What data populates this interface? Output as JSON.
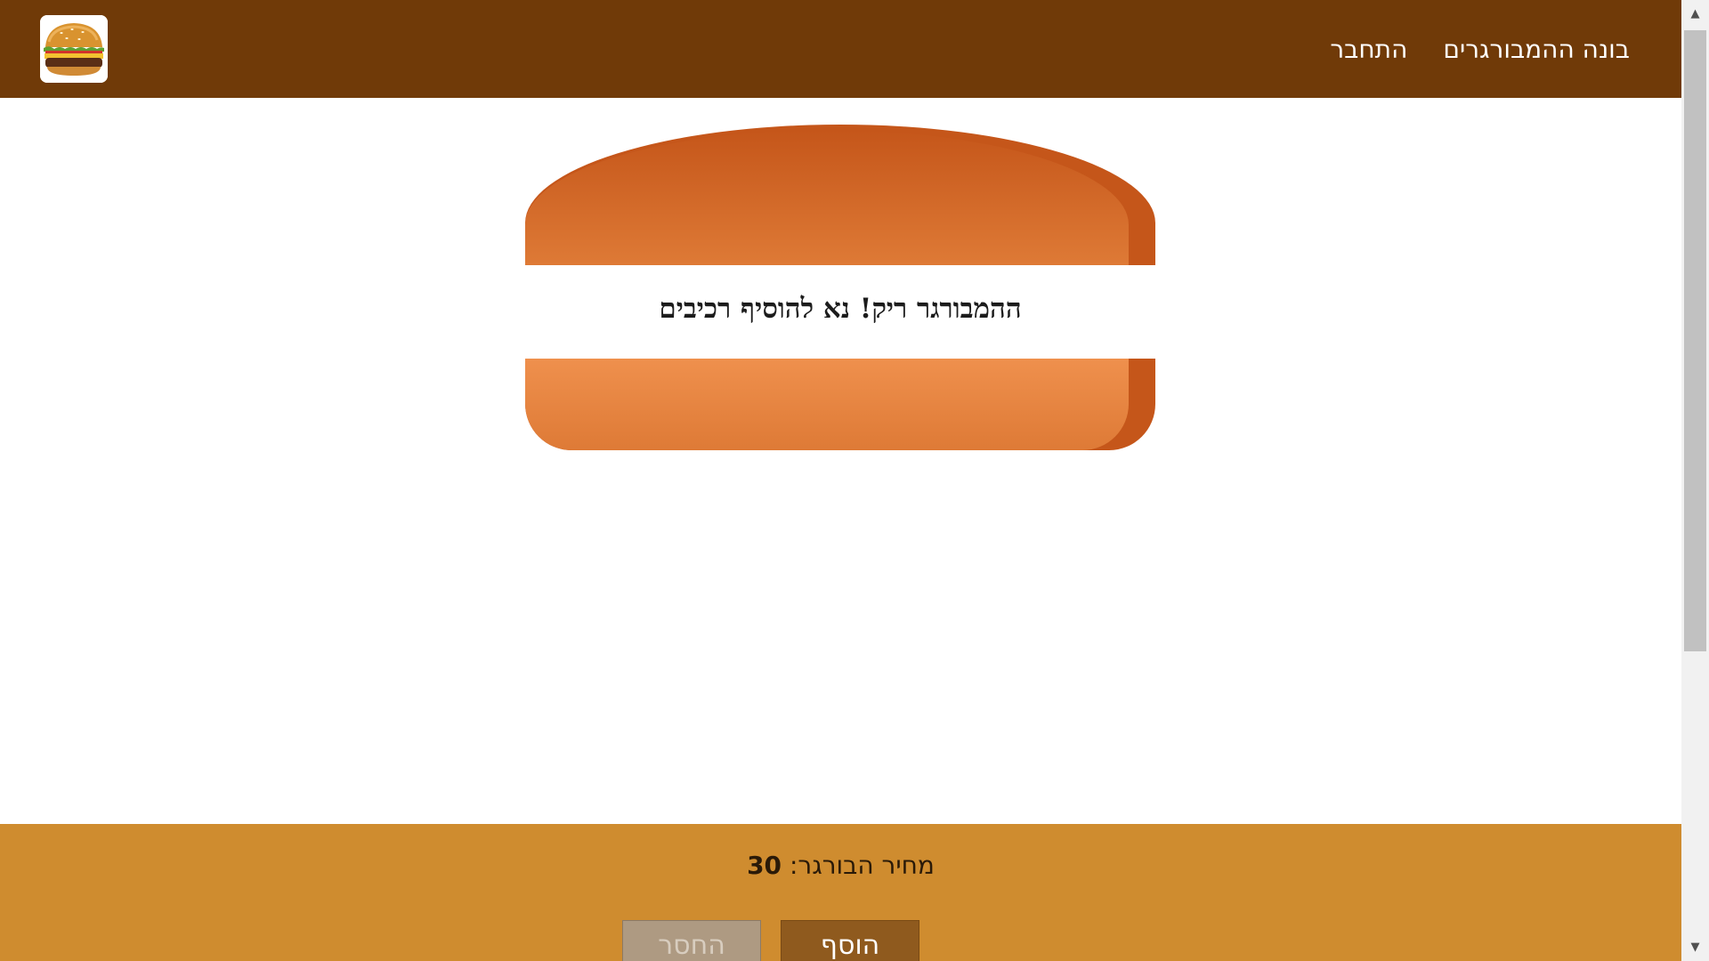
{
  "header": {
    "logo_icon": "hamburger-logo-icon",
    "nav": [
      {
        "label": "בונה ההמבורגרים"
      },
      {
        "label": "התחבר"
      }
    ]
  },
  "burger": {
    "empty_message": "ההמבורגר ריק! נא להוסיף רכיבים"
  },
  "build_controls": {
    "price_label": "מחיר הבורגר:",
    "price_value": "30",
    "less_label": "החסר",
    "more_label": "הוסף"
  },
  "colors": {
    "toolbar": "#703A08",
    "bun": "#DE7A36",
    "controls_bg": "#CF8C2F",
    "more_button": "#8F5A1E",
    "less_button": "#AE9A82"
  }
}
